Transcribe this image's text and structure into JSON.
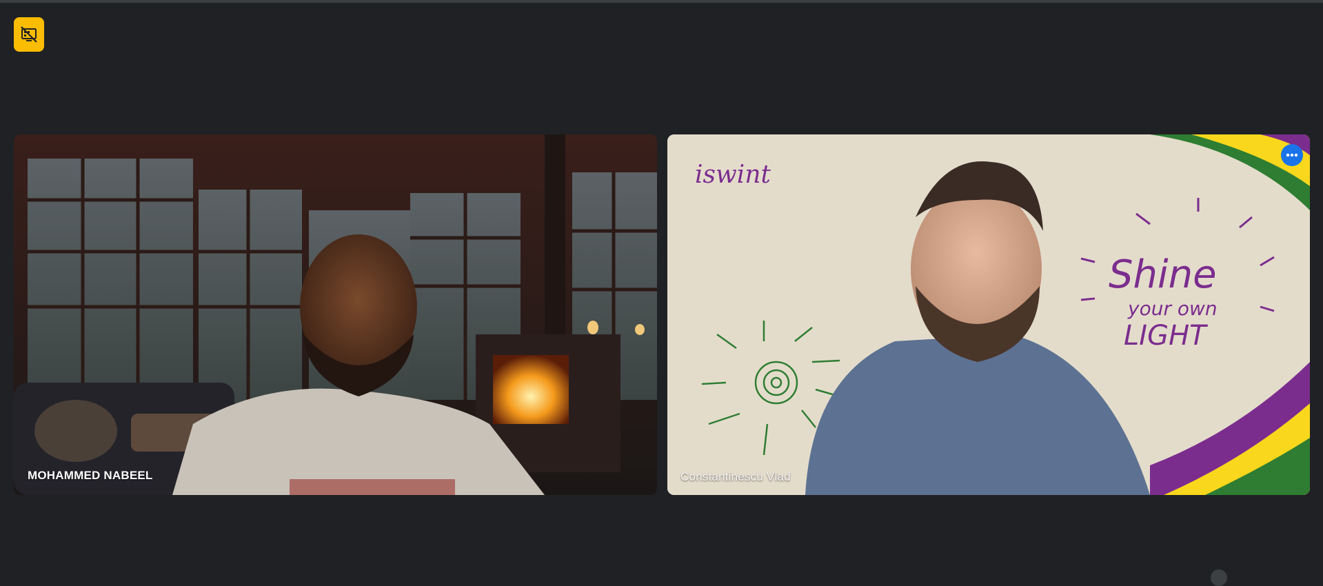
{
  "participants": [
    {
      "name": "MOHAMMED NABEEL"
    },
    {
      "name": "Constantinescu Vlad"
    }
  ],
  "background_text": {
    "logo": "iswint",
    "slogan_line1": "Shine",
    "slogan_line2": "your own",
    "slogan_line3": "LIGHT"
  },
  "icons": {
    "status": "presentation-off-icon",
    "more": "more-options-icon"
  },
  "colors": {
    "page_bg": "#202124",
    "status_button": "#fbbc04",
    "active_speaker_border": "#8ab4f8",
    "more_button": "#1a73e8"
  }
}
